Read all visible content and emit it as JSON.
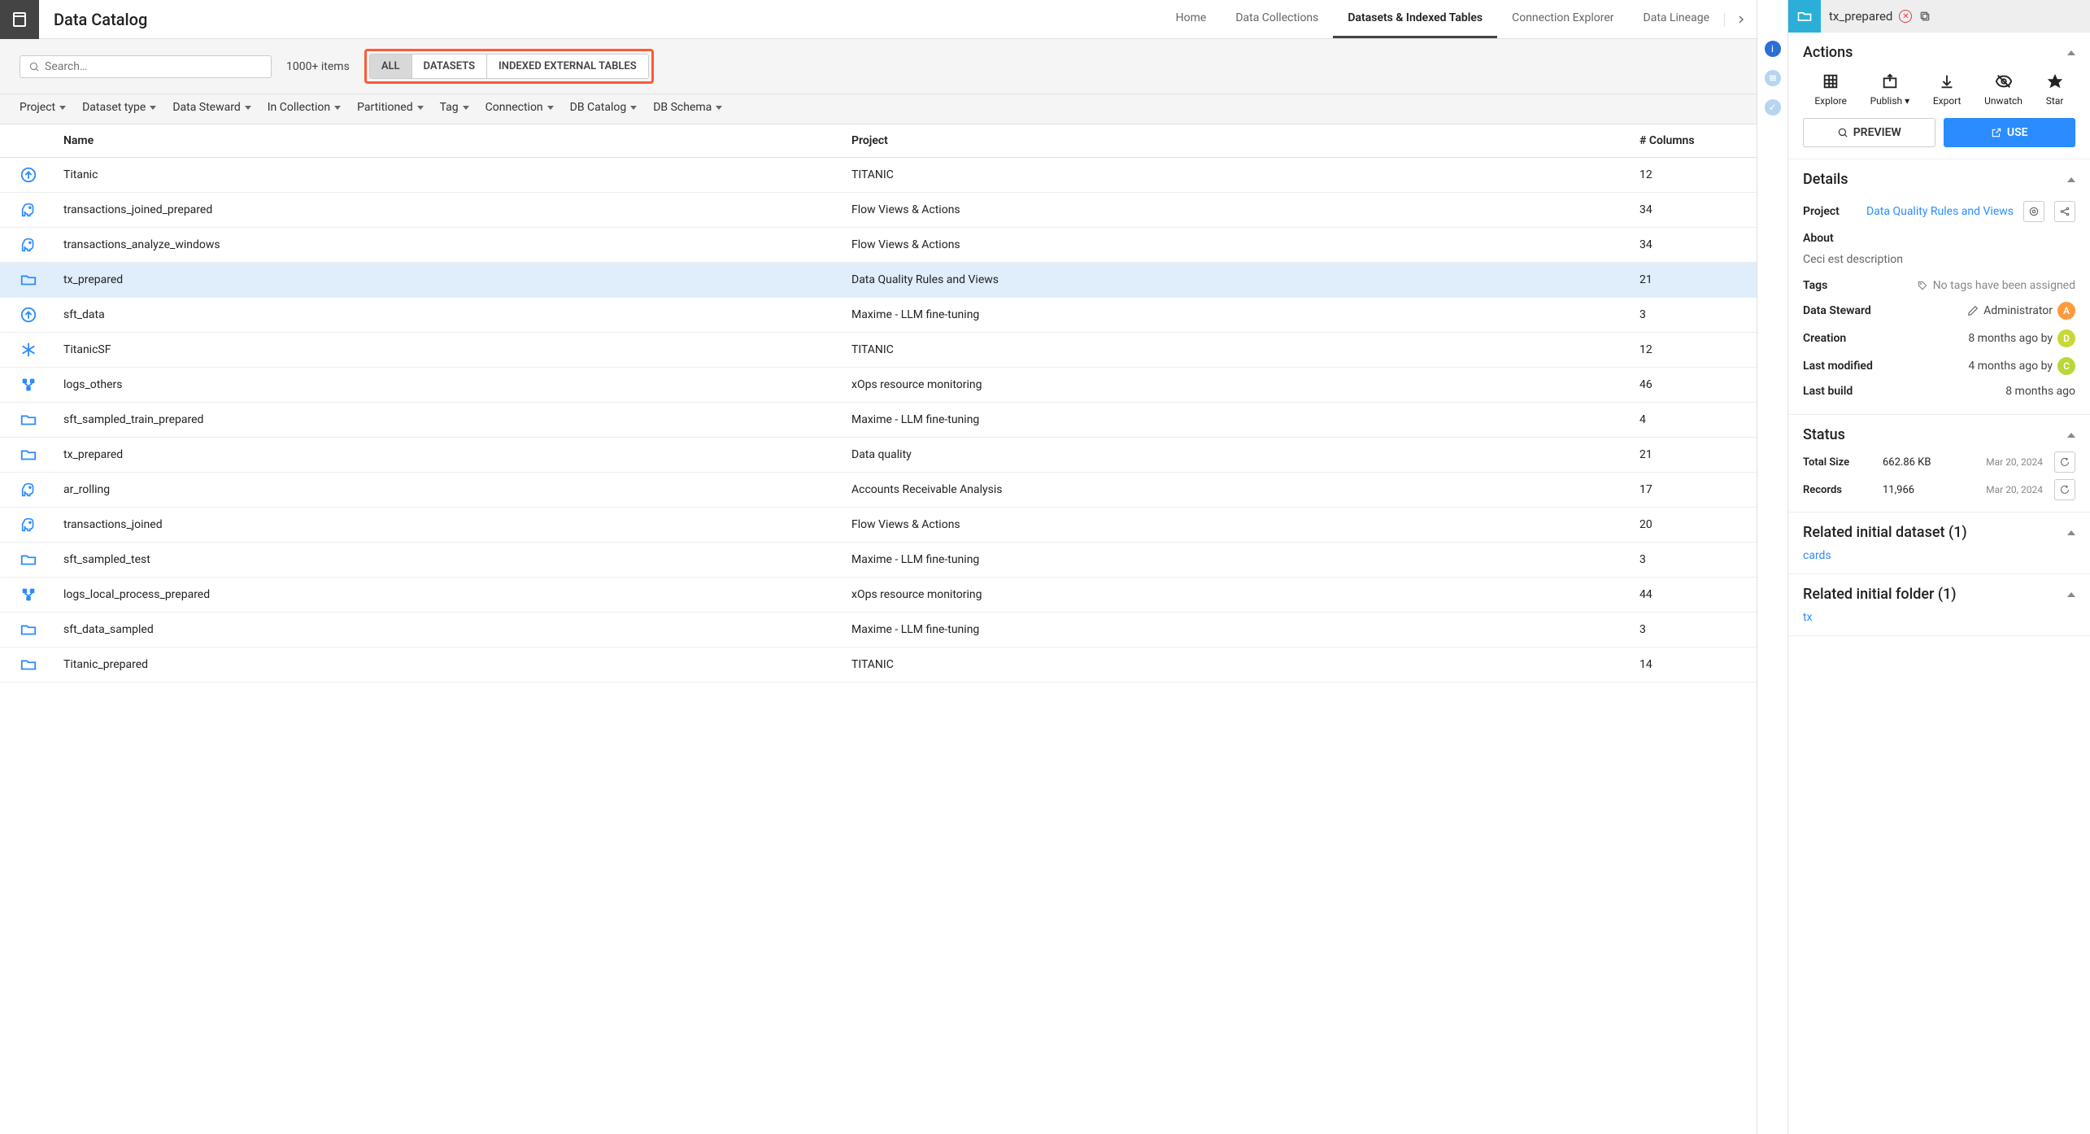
{
  "app_title": "Data Catalog",
  "nav": [
    "Home",
    "Data Collections",
    "Datasets & Indexed Tables",
    "Connection Explorer",
    "Data Lineage"
  ],
  "nav_active": 2,
  "search_placeholder": "Search…",
  "item_count": "1000+ items",
  "type_filters": [
    "ALL",
    "DATASETS",
    "INDEXED EXTERNAL TABLES"
  ],
  "type_active": 0,
  "filters": [
    "Project",
    "Dataset type",
    "Data Steward",
    "In Collection",
    "Partitioned",
    "Tag",
    "Connection",
    "DB Catalog",
    "DB Schema"
  ],
  "columns": {
    "name": "Name",
    "project": "Project",
    "cols": "# Columns"
  },
  "rows": [
    {
      "icon": "upload-circle",
      "name": "Titanic",
      "project": "TITANIC",
      "cols": "12"
    },
    {
      "icon": "elephant",
      "name": "transactions_joined_prepared",
      "project": "Flow Views & Actions",
      "cols": "34"
    },
    {
      "icon": "elephant",
      "name": "transactions_analyze_windows",
      "project": "Flow Views & Actions",
      "cols": "34"
    },
    {
      "icon": "folder",
      "name": "tx_prepared",
      "project": "Data Quality Rules and Views",
      "cols": "21",
      "selected": true
    },
    {
      "icon": "upload-circle",
      "name": "sft_data",
      "project": "Maxime - LLM fine-tuning",
      "cols": "3"
    },
    {
      "icon": "snowflake",
      "name": "TitanicSF",
      "project": "TITANIC",
      "cols": "12"
    },
    {
      "icon": "cluster",
      "name": "logs_others",
      "project": "xOps resource monitoring",
      "cols": "46"
    },
    {
      "icon": "folder",
      "name": "sft_sampled_train_prepared",
      "project": "Maxime - LLM fine-tuning",
      "cols": "4"
    },
    {
      "icon": "folder",
      "name": "tx_prepared",
      "project": "Data quality",
      "cols": "21"
    },
    {
      "icon": "elephant",
      "name": "ar_rolling",
      "project": "Accounts Receivable Analysis",
      "cols": "17"
    },
    {
      "icon": "elephant",
      "name": "transactions_joined",
      "project": "Flow Views & Actions",
      "cols": "20"
    },
    {
      "icon": "folder",
      "name": "sft_sampled_test",
      "project": "Maxime - LLM fine-tuning",
      "cols": "3"
    },
    {
      "icon": "cluster",
      "name": "logs_local_process_prepared",
      "project": "xOps resource monitoring",
      "cols": "44"
    },
    {
      "icon": "folder",
      "name": "sft_data_sampled",
      "project": "Maxime - LLM fine-tuning",
      "cols": "3"
    },
    {
      "icon": "folder",
      "name": "Titanic_prepared",
      "project": "TITANIC",
      "cols": "14"
    }
  ],
  "panel": {
    "title": "tx_prepared",
    "actions_title": "Actions",
    "actions": [
      {
        "icon": "grid",
        "label": "Explore"
      },
      {
        "icon": "publish",
        "label": "Publish",
        "dropdown": true
      },
      {
        "icon": "download",
        "label": "Export"
      },
      {
        "icon": "eye-off",
        "label": "Unwatch"
      },
      {
        "icon": "star",
        "label": "Star"
      }
    ],
    "preview_btn": "PREVIEW",
    "use_btn": "USE",
    "details_title": "Details",
    "project_label": "Project",
    "project_value": "Data Quality Rules and Views",
    "about_label": "About",
    "about_value": "Ceci est description",
    "tags_label": "Tags",
    "tags_value": "No tags have been assigned",
    "steward_label": "Data Steward",
    "steward_value": "Administrator",
    "creation_label": "Creation",
    "creation_value": "8 months ago by",
    "modified_label": "Last modified",
    "modified_value": "4 months ago by",
    "build_label": "Last build",
    "build_value": "8 months ago",
    "status_title": "Status",
    "size_label": "Total Size",
    "size_value": "662.86 KB",
    "size_date": "Mar 20, 2024",
    "records_label": "Records",
    "records_value": "11,966",
    "records_date": "Mar 20, 2024",
    "related_dataset_title": "Related initial dataset (1)",
    "related_dataset_link": "cards",
    "related_folder_title": "Related initial folder (1)",
    "related_folder_link": "tx"
  }
}
